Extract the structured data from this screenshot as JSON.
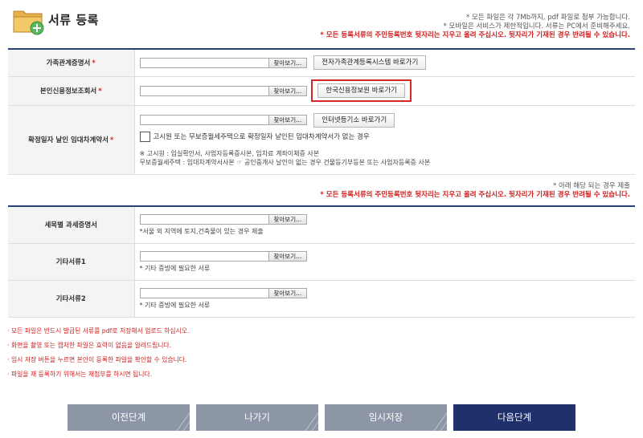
{
  "header": {
    "title": "서류 등록",
    "notices_gray": [
      "* 모든 파일은 각 7Mb까지, pdf 파일로 첨부 가능합니다.",
      "* 모바일은 서비스가 제한적입니다. 서류는 PC에서 준비해주세요."
    ],
    "notice_red": "* 모든 등록서류의 주민등록번호 뒷자리는 지우고 올려 주십시오. 뒷자리가 기재된 경우 반려될 수 있습니다."
  },
  "section1": {
    "rows": [
      {
        "label": "가족관계증명서",
        "required_mark": "*",
        "browse_label": "찾아보기...",
        "link_label": "전자가족관계등록시스템 바로가기"
      },
      {
        "label": "본인신용정보조회서",
        "required_mark": "*",
        "browse_label": "찾아보기...",
        "link_label": "한국신용정보원 바로가기"
      },
      {
        "label": "확정일자 날인 임대차계약서",
        "required_mark": "*",
        "browse_label": "찾아보기...",
        "link_label": "인터넷등기소 바로가기",
        "checkbox_label": "고시원 또는 무보증월세주택으로 확정일자 날인된 임대차계약서가 없는 경우",
        "notes": [
          "※ 고시원 : 입실확인서, 사업자등록증사본, 임차료 계좌이체증 사본",
          "무보증월세주택 : 임대차계약서사본 ☞ 공인중개사 날인이 없는 경우 건물등기부등본 또는 사업자등록증 사본"
        ]
      }
    ]
  },
  "mid_notices": {
    "gray": "* 아래 해당 되는 경우 제출",
    "red": "* 모든 등록서류의 주민등록번호 뒷자리는 지우고 올려 주십시오. 뒷자리가 기재된 경우 반려될 수 있습니다."
  },
  "section2": {
    "rows": [
      {
        "label": "세목별 과세증명서",
        "browse_label": "찾아보기...",
        "hint": "*서울 외 지역에 토지,건축물이 있는 경우 제출"
      },
      {
        "label": "기타서류1",
        "browse_label": "찾아보기...",
        "hint": "* 기타 증빙에 필요한 서류"
      },
      {
        "label": "기타서류2",
        "browse_label": "찾아보기...",
        "hint": "* 기타 증빙에 필요한 서류"
      }
    ]
  },
  "bottom_notes": [
    "· 모든 파일은 반드시 발급된 서류를 pdf로 저장해서 업로드 하십시오.",
    "· 화면을 촬영 또는 캡처한 파일은 효력이 없음을 알려드립니다.",
    "· 임시 저장 버튼을 누르면 본인이 등록한 파일을 확인할 수 있습니다.",
    "· 파일을 재 등록하기 위해서는 재첨부를 하시면 됩니다."
  ],
  "buttons": {
    "prev": "이전단계",
    "exit": "나가기",
    "temp_save": "임시저장",
    "next": "다음단계"
  },
  "colors": {
    "accent_navy": "#20306a",
    "button_gray": "#8d96a6",
    "notice_red": "#d21d1d",
    "highlight_red": "#d32828"
  },
  "icons": {
    "header": "folder-add-icon",
    "button_decoration": "slash-lines-icon"
  }
}
